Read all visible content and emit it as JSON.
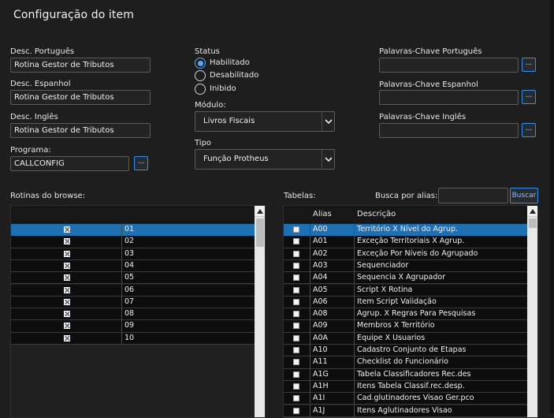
{
  "window": {
    "title": "Configuração do item"
  },
  "fields": {
    "desc_pt": {
      "label": "Desc. Português",
      "value": "Rotina Gestor de Tributos"
    },
    "desc_es": {
      "label": "Desc. Espanhol",
      "value": "Rotina Gestor de Tributos"
    },
    "desc_en": {
      "label": "Desc. Inglês",
      "value": "Rotina Gestor de Tributos"
    },
    "programa": {
      "label": "Programa:",
      "value": "CALLCONFIG",
      "button": "..."
    }
  },
  "status": {
    "label": "Status",
    "options": [
      {
        "label": "Habilitado",
        "selected": true
      },
      {
        "label": "Desabilitado",
        "selected": false
      },
      {
        "label": "Inibido",
        "selected": false
      }
    ]
  },
  "modulo": {
    "label": "Módulo:",
    "value": "Livros Fiscais"
  },
  "tipo": {
    "label": "Tipo",
    "value": "Função Protheus"
  },
  "keywords": {
    "pt": {
      "label": "Palavras-Chave Português",
      "value": "",
      "button": "..."
    },
    "es": {
      "label": "Palavras-Chave Espanhol",
      "value": "",
      "button": "..."
    },
    "en": {
      "label": "Palavras-Chave Inglês",
      "value": "",
      "button": "..."
    }
  },
  "browse": {
    "label": "Rotinas do browse:",
    "rows": [
      "01",
      "02",
      "03",
      "04",
      "05",
      "06",
      "07",
      "08",
      "09",
      "10"
    ]
  },
  "tabelas": {
    "label": "Tabelas:",
    "search_label": "Busca por alias:",
    "search_value": "",
    "search_button": "Buscar",
    "headers": {
      "alias": "Alias",
      "descricao": "Descrição"
    },
    "rows": [
      {
        "alias": "A00",
        "desc": "Território X Nível do Agrup."
      },
      {
        "alias": "A01",
        "desc": "Exceção Territoriais X Agrup."
      },
      {
        "alias": "A02",
        "desc": "Exceção Por Níveis do Agrupado"
      },
      {
        "alias": "A03",
        "desc": "Sequenciador"
      },
      {
        "alias": "A04",
        "desc": "Sequencia X Agrupador"
      },
      {
        "alias": "A05",
        "desc": "Script X Rotina"
      },
      {
        "alias": "A06",
        "desc": "Item Script Validação"
      },
      {
        "alias": "A08",
        "desc": "Agrup. X Regras Para Pesquisas"
      },
      {
        "alias": "A09",
        "desc": "Membros X Território"
      },
      {
        "alias": "A0A",
        "desc": "Equipe X Usuarios"
      },
      {
        "alias": "A10",
        "desc": "Cadastro Conjunto de Etapas"
      },
      {
        "alias": "A11",
        "desc": "Checklist do Funcionário"
      },
      {
        "alias": "A1G",
        "desc": "Tabela Classificadores Rec.des"
      },
      {
        "alias": "A1H",
        "desc": "Itens Tabela Classif.rec.desp."
      },
      {
        "alias": "A1I",
        "desc": "Cad.glutinadores Visao Ger.pco"
      },
      {
        "alias": "A1J",
        "desc": "Itens Aglutinadores Visao"
      }
    ]
  },
  "colors": {
    "accent": "#3a8ee6",
    "selection": "#1f6fb3",
    "background": "#1e1e1e"
  }
}
